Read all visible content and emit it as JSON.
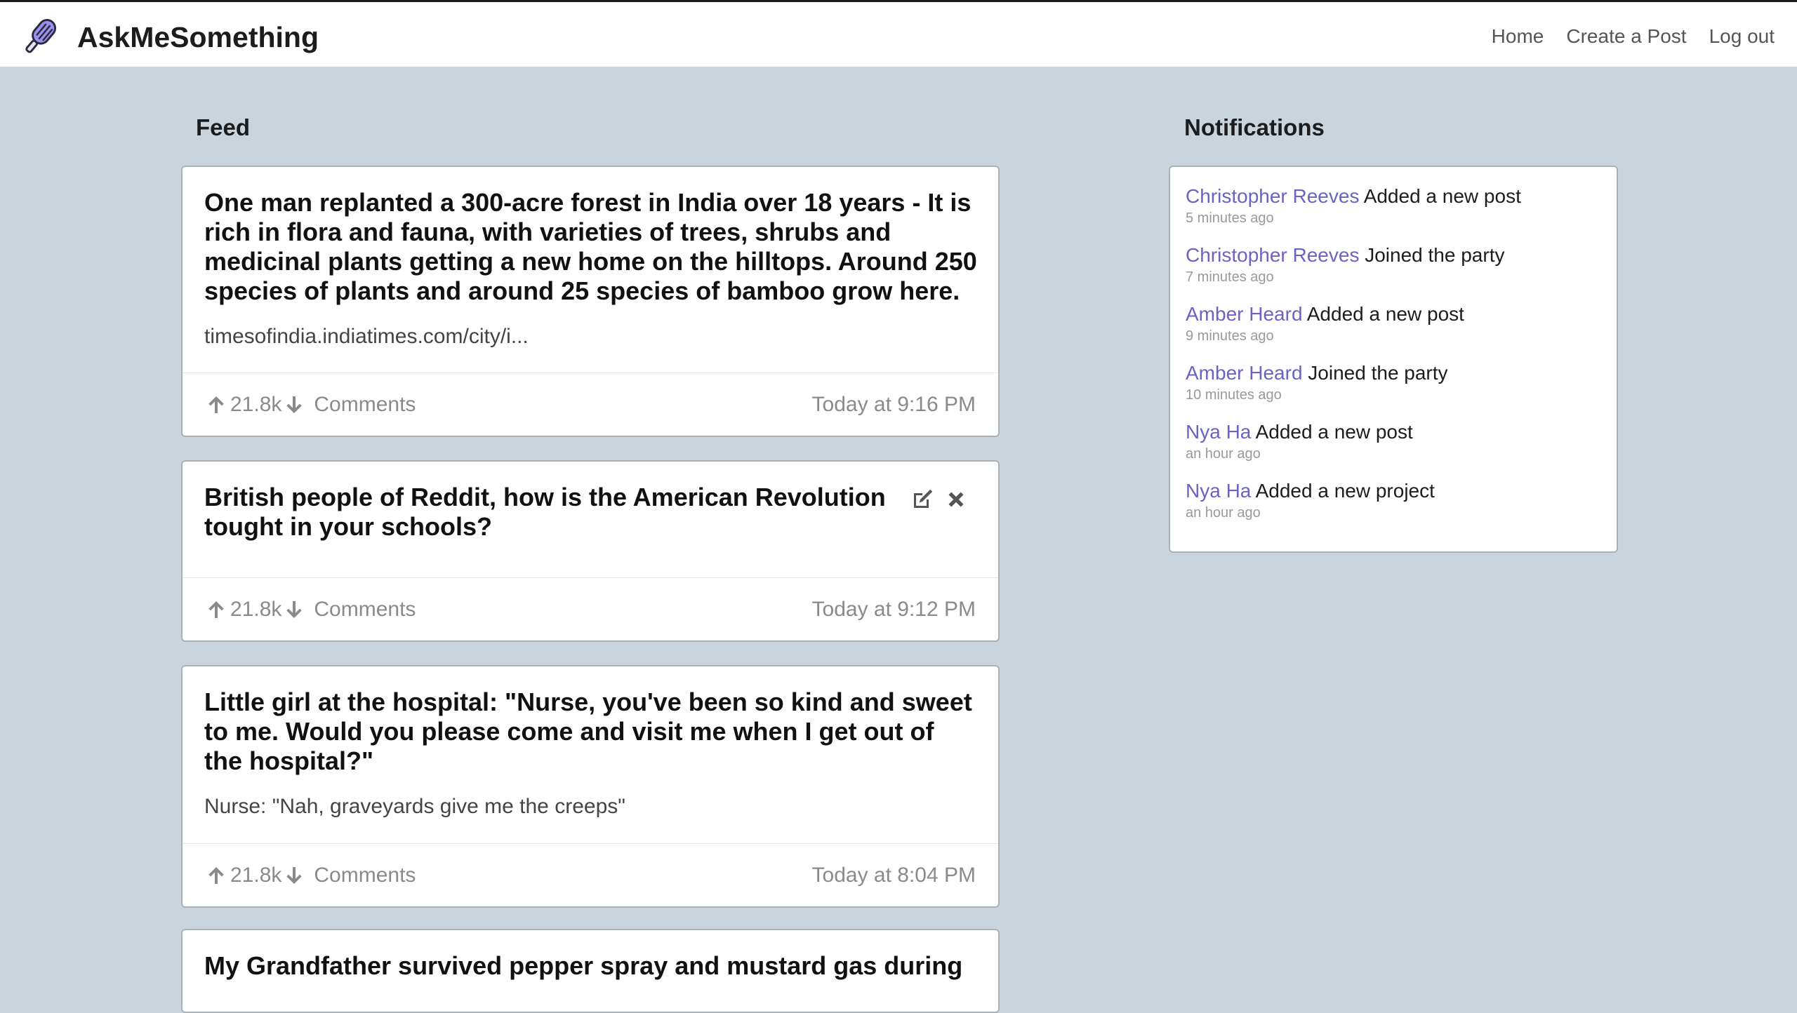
{
  "app": {
    "brand": "AskMeSomething",
    "brand_color": "#8b7fe0"
  },
  "nav": {
    "home": "Home",
    "create_post": "Create a Post",
    "logout": "Log out"
  },
  "feed": {
    "title": "Feed",
    "posts": [
      {
        "title": "One man replanted a 300-acre forest in India over 18 years - It is rich in flora and fauna, with varieties of trees, shrubs and medicinal plants getting a new home on the hilltops. Around 250 species of plants and around 25 species of bamboo grow here.",
        "description": "timesofindia.indiatimes.com/city/i...",
        "votes": "21.8k",
        "comments": "Comments",
        "time": "Today at 9:16 PM"
      },
      {
        "title": "British people of Reddit, how is the American Revolution tought in your schools?",
        "description": "",
        "votes": "21.8k",
        "comments": "Comments",
        "time": "Today at 9:12 PM"
      },
      {
        "title": "Little girl at the hospital: \"Nurse, you've been so kind and sweet to me. Would you please come and visit me when I get out of the hospital?\"",
        "description": "Nurse: \"Nah, graveyards give me the creeps\"",
        "votes": "21.8k",
        "comments": "Comments",
        "time": "Today at 8:04 PM"
      },
      {
        "title": "My Grandfather survived pepper spray and mustard gas during",
        "description": "",
        "votes": "",
        "comments": "",
        "time": ""
      }
    ]
  },
  "notifications": {
    "title": "Notifications",
    "items": [
      {
        "user": "Christopher Reeves",
        "action": "Added a new post",
        "time": "5 minutes ago"
      },
      {
        "user": "Christopher Reeves",
        "action": "Joined the party",
        "time": "7 minutes ago"
      },
      {
        "user": "Amber Heard",
        "action": "Added a new post",
        "time": "9 minutes ago"
      },
      {
        "user": "Amber Heard",
        "action": "Joined the party",
        "time": "10 minutes ago"
      },
      {
        "user": "Nya Ha",
        "action": "Added a new post",
        "time": "an hour ago"
      },
      {
        "user": "Nya Ha",
        "action": "Added a new project",
        "time": "an hour ago"
      }
    ]
  },
  "icons": {
    "upvote": "arrow-up-icon",
    "downvote": "arrow-down-icon",
    "edit": "edit-icon",
    "delete": "close-icon",
    "logo": "popsicle-icon"
  }
}
